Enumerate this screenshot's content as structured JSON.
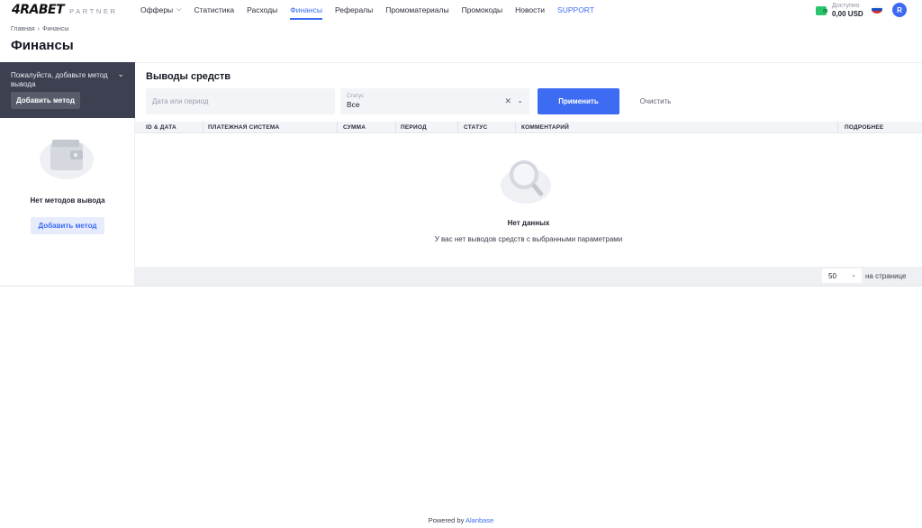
{
  "brand": {
    "logo": "4RABET",
    "logo_sub": "PARTNER"
  },
  "nav": {
    "items": [
      {
        "label": "Офферы",
        "has_dropdown": true
      },
      {
        "label": "Статистика"
      },
      {
        "label": "Расходы"
      },
      {
        "label": "Финансы",
        "active": true
      },
      {
        "label": "Рефералы"
      },
      {
        "label": "Промоматериалы"
      },
      {
        "label": "Промокоды"
      },
      {
        "label": "Новости"
      },
      {
        "label": "SUPPORT"
      }
    ]
  },
  "balance": {
    "label": "Доступно",
    "value": "0,00 USD",
    "icon": "wallet-icon"
  },
  "user": {
    "avatar_letter": "R",
    "flag_icon": "russia-flag-icon"
  },
  "breadcrumb": {
    "home": "Главная",
    "current": "Финансы"
  },
  "page": {
    "title": "Финансы"
  },
  "sidebar": {
    "prompt": "Пожалуйста, добавьте метод вывода",
    "add_button": "Добавить метод",
    "empty_text": "Нет методов вывода",
    "empty_add_button": "Добавить метод"
  },
  "withdrawals": {
    "title": "Выводы средств",
    "date_placeholder": "Дата или период",
    "status_label": "Статус",
    "status_value": "Все",
    "apply_button": "Применить",
    "clear_button": "Очистить",
    "columns": [
      "ID & ДАТА",
      "ПЛАТЕЖНАЯ СИСТЕМА",
      "СУММА",
      "ПЕРИОД",
      "СТАТУС",
      "КОММЕНТАРИЙ",
      "ПОДРОБНЕЕ"
    ],
    "empty_title": "Нет данных",
    "empty_text": "У вас нет выводов средств с выбранными параметрами",
    "per_page_value": "50",
    "per_page_label": "на странице"
  },
  "footer": {
    "powered_by": "Powered by",
    "brand": "Alanbase"
  },
  "colors": {
    "accent": "#3d6bf2",
    "sidebar_dark": "#3c4050",
    "wallet_green": "#2ac46a"
  }
}
